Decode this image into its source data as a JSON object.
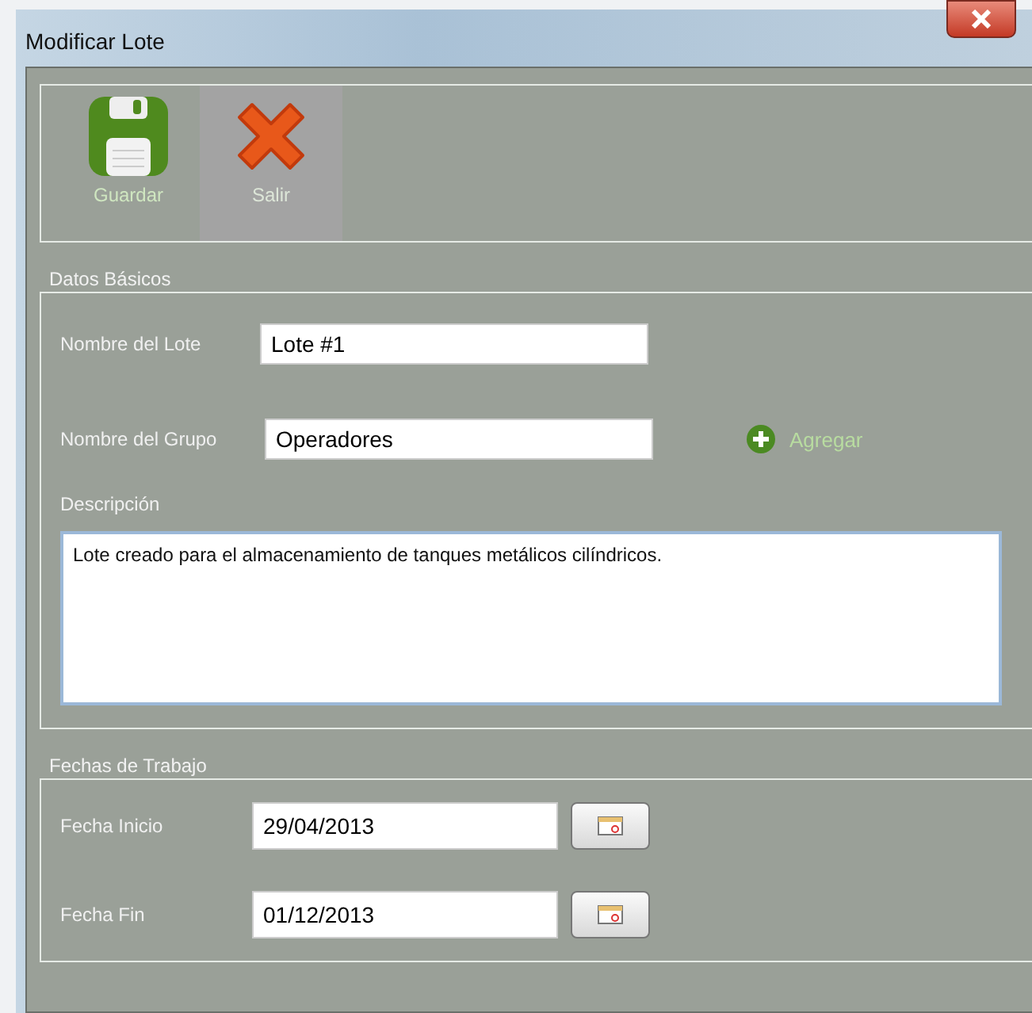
{
  "window": {
    "title": "Modificar Lote"
  },
  "toolbar": [
    {
      "kind": "save",
      "label": "Guardar"
    },
    {
      "kind": "exit",
      "label": "Salir"
    }
  ],
  "basic": {
    "title": "Datos Básicos",
    "lote_label": "Nombre del Lote",
    "lote_value": "Lote #1",
    "grupo_label": "Nombre del Grupo",
    "grupo_value": "Operadores",
    "add_label": "Agregar",
    "desc_label": "Descripción",
    "desc_value": "Lote creado para el almacenamiento de tanques metálicos cilíndricos."
  },
  "dates": {
    "title": "Fechas de Trabajo",
    "rows": [
      {
        "label": "Fecha Inicio",
        "value": "29/04/2013"
      },
      {
        "label": "Fecha Fin",
        "value": "01/12/2013"
      }
    ]
  }
}
